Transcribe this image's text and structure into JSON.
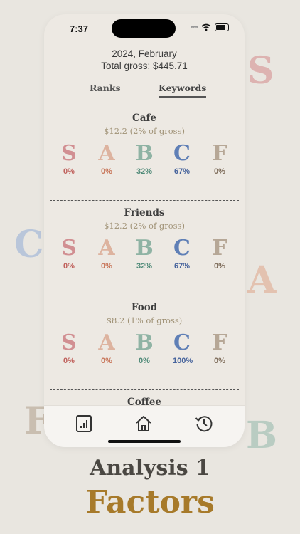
{
  "colors": {
    "S": "#d18f92",
    "A": "#ddb39f",
    "B": "#8fb3a4",
    "C": "#5f7fb6",
    "F": "#b6a796",
    "pct_S": "#c0615c",
    "pct_A": "#c8765a",
    "pct_B": "#4f8a78",
    "pct_C": "#46639c",
    "pct_F": "#7e6c5a"
  },
  "background_letters": [
    "S",
    "C",
    "A",
    "F",
    "B"
  ],
  "status": {
    "time": "7:37",
    "signal": "••••"
  },
  "header": {
    "period": "2024, February",
    "total": "Total gross: $445.71"
  },
  "tabs": {
    "ranks": "Ranks",
    "keywords": "Keywords"
  },
  "keywords": [
    {
      "name": "Cafe",
      "summary": "$12.2 (2% of gross)",
      "grades": [
        {
          "letter": "S",
          "pct": "0%"
        },
        {
          "letter": "A",
          "pct": "0%"
        },
        {
          "letter": "B",
          "pct": "32%"
        },
        {
          "letter": "C",
          "pct": "67%"
        },
        {
          "letter": "F",
          "pct": "0%"
        }
      ]
    },
    {
      "name": "Friends",
      "summary": "$12.2 (2% of gross)",
      "grades": [
        {
          "letter": "S",
          "pct": "0%"
        },
        {
          "letter": "A",
          "pct": "0%"
        },
        {
          "letter": "B",
          "pct": "32%"
        },
        {
          "letter": "C",
          "pct": "67%"
        },
        {
          "letter": "F",
          "pct": "0%"
        }
      ]
    },
    {
      "name": "Food",
      "summary": "$8.2 (1% of gross)",
      "grades": [
        {
          "letter": "S",
          "pct": "0%"
        },
        {
          "letter": "A",
          "pct": "0%"
        },
        {
          "letter": "B",
          "pct": "0%"
        },
        {
          "letter": "C",
          "pct": "100%"
        },
        {
          "letter": "F",
          "pct": "0%"
        }
      ]
    }
  ],
  "next_keyword": "Coffee",
  "tabbar": [
    "report-icon",
    "home-icon",
    "history-icon"
  ],
  "caption": {
    "line1": "Analysis 1",
    "line2": "Factors"
  }
}
